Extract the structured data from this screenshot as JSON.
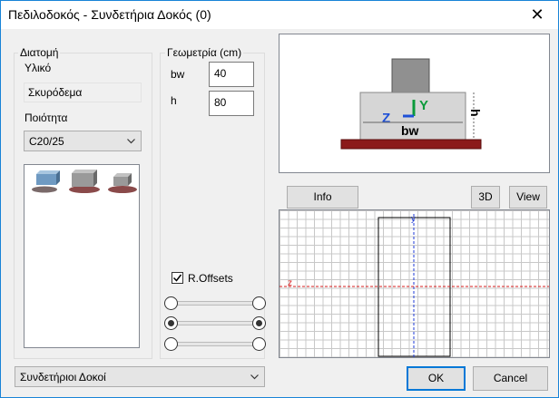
{
  "window": {
    "title": "Πεδιλοδοκός - Συνδετήρια Δοκός (0)"
  },
  "section": {
    "group_label": "Διατομή",
    "material_label": "Υλικό",
    "material_value": "Σκυρόδεμα",
    "quality_label": "Ποιότητα",
    "quality_value": "C20/25"
  },
  "geometry": {
    "group_label": "Γεωμετρία (cm)",
    "bw_label": "bw",
    "bw_value": "40",
    "h_label": "h",
    "h_value": "80"
  },
  "offsets": {
    "checkbox_label": "R.Offsets",
    "checked": true
  },
  "bottom": {
    "type_value": "Συνδετήριοι Δοκοί"
  },
  "preview": {
    "z_label": "Z",
    "y_label": "Y",
    "bw_label": "bw",
    "h_label": "h"
  },
  "viewer": {
    "info_button": "Info",
    "3d_button": "3D",
    "view_button": "View",
    "z_axis": "z",
    "y_axis": "y"
  },
  "actions": {
    "ok": "OK",
    "cancel": "Cancel"
  },
  "colors": {
    "accent": "#0078d7",
    "footing": "#8b1a1a",
    "section_fill": "#d6d6d6"
  }
}
